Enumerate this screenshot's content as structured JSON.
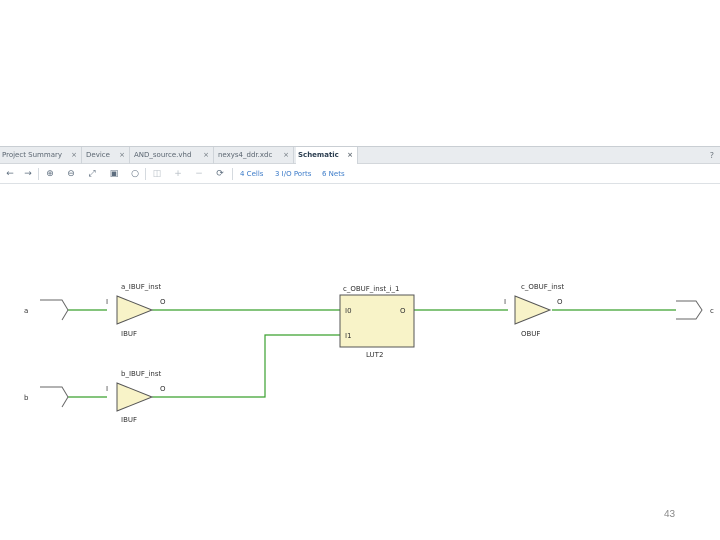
{
  "tabs": [
    {
      "label": "Project Summary",
      "active": false,
      "closable": true
    },
    {
      "label": "Device",
      "active": false,
      "closable": true
    },
    {
      "label": "AND_source.vhd",
      "active": false,
      "closable": true
    },
    {
      "label": "nexys4_ddr.xdc",
      "active": false,
      "closable": true
    },
    {
      "label": "Schematic",
      "active": true,
      "closable": true
    }
  ],
  "help_label": "?",
  "close_glyph": "×",
  "toolbar": {
    "icons": [
      "back-arrow-icon",
      "forward-arrow-icon",
      "zoom-in-icon",
      "zoom-out-icon",
      "fit-view-icon",
      "fit-selection-icon",
      "circle-icon",
      "copy-icon",
      "plus-icon",
      "minus-icon",
      "refresh-icon"
    ],
    "cells": "4 Cells",
    "io_ports": "3 I/O Ports",
    "nets": "6 Nets"
  },
  "schematic": {
    "ports": {
      "a": "a",
      "b": "b",
      "c": "c"
    },
    "a_buf": {
      "inst": "a_IBUF_inst",
      "pin_in": "I",
      "pin_out": "O",
      "type": "IBUF"
    },
    "b_buf": {
      "inst": "b_IBUF_inst",
      "pin_in": "I",
      "pin_out": "O",
      "type": "IBUF"
    },
    "lut": {
      "inst": "c_OBUF_inst_i_1",
      "pin_i0": "I0",
      "pin_i1": "I1",
      "pin_out": "O",
      "type": "LUT2"
    },
    "c_buf": {
      "inst": "c_OBUF_inst",
      "pin_in": "I",
      "pin_out": "O",
      "type": "OBUF"
    },
    "colors": {
      "wire": "#3aa02e",
      "cell_fill": "#f8f3c8",
      "cell_stroke": "#555555"
    }
  },
  "page_number": "43"
}
